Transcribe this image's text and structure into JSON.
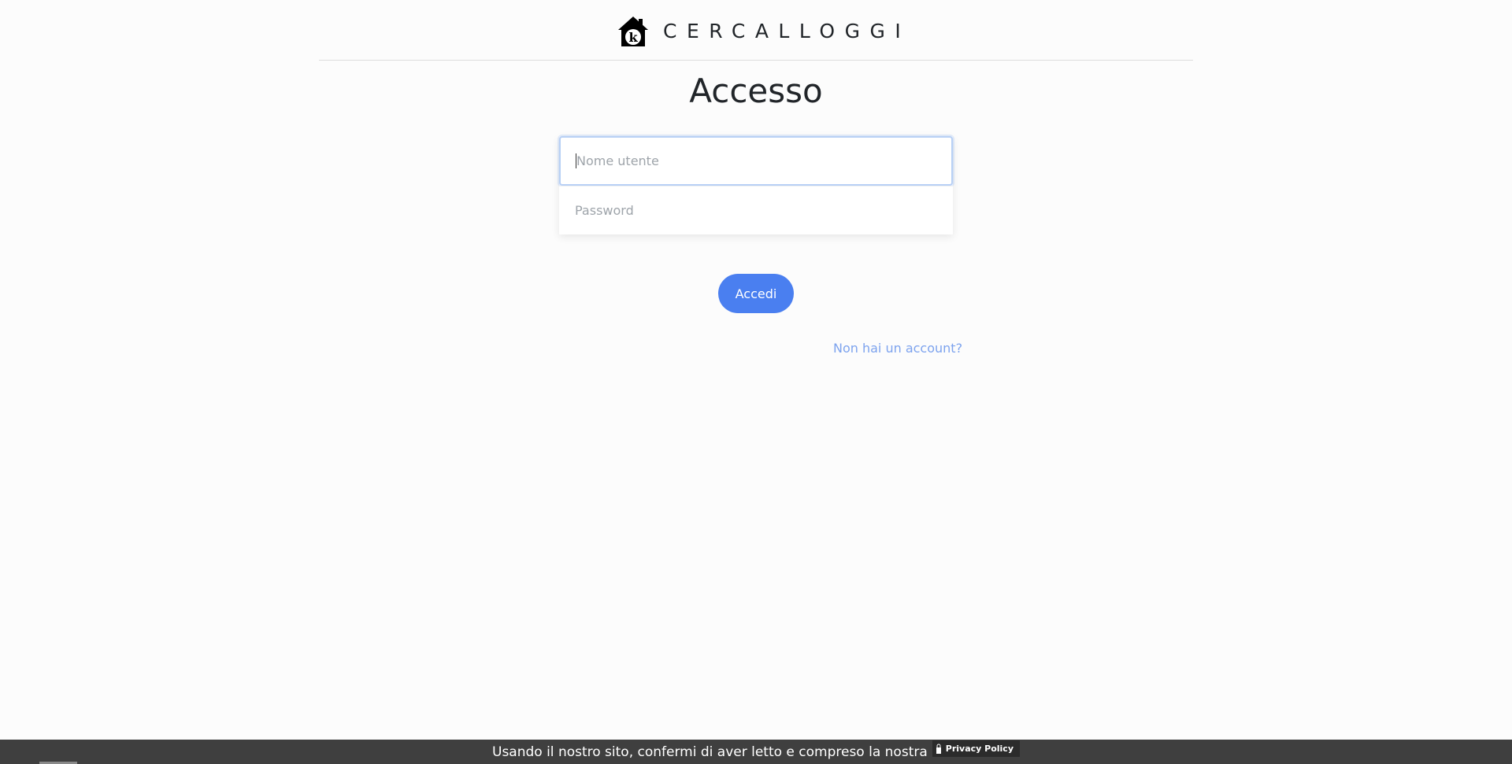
{
  "header": {
    "brand": "CERCALLOGGI",
    "logo_icon": "house-k-logo-icon"
  },
  "login": {
    "title": "Accesso",
    "username_placeholder": "Nome utente",
    "password_placeholder": "Password",
    "submit_label": "Accedi",
    "signup_link": "Non hai un account?"
  },
  "cookie_bar": {
    "text": "Usando il nostro sito, confermi di aver letto e compreso la nostra",
    "policy_label": "Privacy Policy",
    "policy_icon": "lock-icon"
  },
  "colors": {
    "accent": "#4a7ff0",
    "link": "#7da3ee",
    "cookie_bar": "#3f3f3f"
  }
}
